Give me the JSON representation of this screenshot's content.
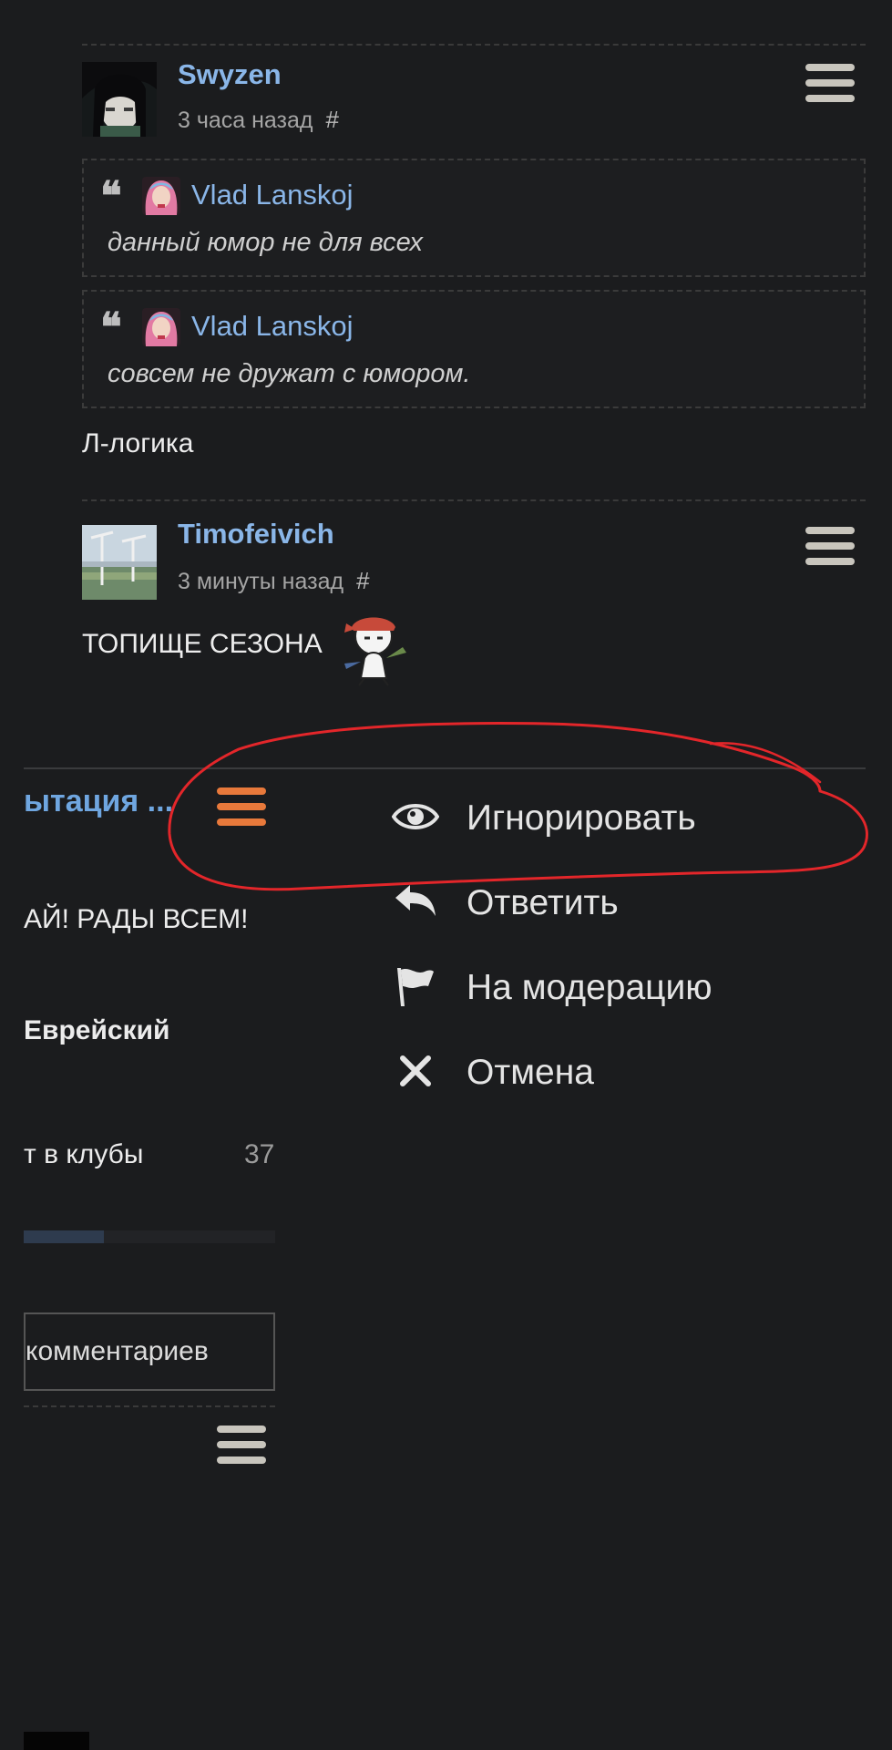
{
  "comments": [
    {
      "author": "Swyzen",
      "time": "3 часа назад",
      "hash": "#",
      "quotes": [
        {
          "author": "Vlad Lanskoj",
          "text": "данный юмор не для всех"
        },
        {
          "author": "Vlad Lanskoj",
          "text": "совсем не дружат с юмором."
        }
      ],
      "body": "Л-логика"
    },
    {
      "author": "Timofeivich",
      "time": "3 минуты назад",
      "hash": "#",
      "body": "ТОПИЩЕ СЕЗОНА"
    }
  ],
  "left_panel": {
    "header": "ытация ...",
    "welcome": "АЙ! РАДЫ ВСЕМ!",
    "language": "Еврейский",
    "clubs_label": "т в клубы",
    "clubs_count": "37",
    "progress": 0.32,
    "comments_button": "комментариев"
  },
  "context_menu": {
    "items": [
      {
        "label": "Игнорировать",
        "icon": "eye-icon"
      },
      {
        "label": "Ответить",
        "icon": "reply-icon"
      },
      {
        "label": "На модерацию",
        "icon": "flag-icon"
      },
      {
        "label": "Отмена",
        "icon": "close-icon"
      }
    ]
  },
  "colors": {
    "background": "#1b1c1e",
    "link": "#8ab6e8",
    "accent_orange": "#e8793b",
    "annotation_red": "#e3262a"
  }
}
